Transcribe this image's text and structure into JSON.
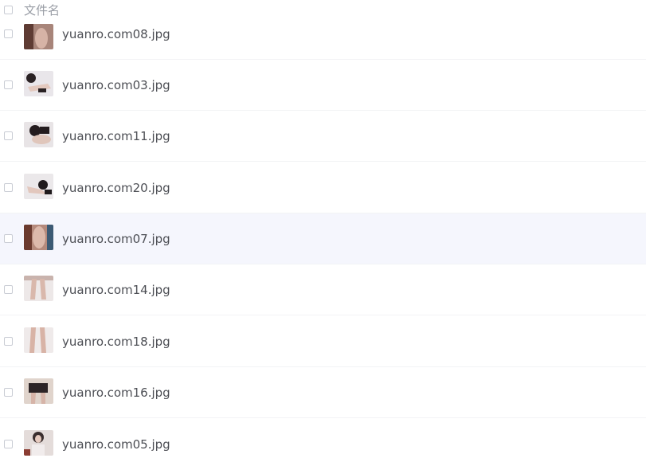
{
  "header": {
    "label": "文件名"
  },
  "files": [
    {
      "name": "yuanro.com08.jpg",
      "thumb_colors": [
        "#a8857a",
        "#5e3b33"
      ]
    },
    {
      "name": "yuanro.com03.jpg",
      "thumb_colors": [
        "#e9e6ea",
        "#2a2224"
      ]
    },
    {
      "name": "yuanro.com11.jpg",
      "thumb_colors": [
        "#e8e4e6",
        "#241c1e"
      ]
    },
    {
      "name": "yuanro.com20.jpg",
      "thumb_colors": [
        "#ebe8ea",
        "#1f1a1c"
      ]
    },
    {
      "name": "yuanro.com07.jpg",
      "thumb_colors": [
        "#b58a7c",
        "#6b3a2e"
      ]
    },
    {
      "name": "yuanro.com14.jpg",
      "thumb_colors": [
        "#ede8e8",
        "#d9b8ac"
      ]
    },
    {
      "name": "yuanro.com18.jpg",
      "thumb_colors": [
        "#efeaea",
        "#d8b3a6"
      ]
    },
    {
      "name": "yuanro.com16.jpg",
      "thumb_colors": [
        "#e0d4cc",
        "#2c2426"
      ]
    },
    {
      "name": "yuanro.com05.jpg",
      "thumb_colors": [
        "#e4dcda",
        "#3a2e2e"
      ]
    }
  ],
  "colors": {
    "hover_row": "#f5f6fd",
    "filename_text": "#4d4f55",
    "header_text": "#9a9ea6"
  }
}
